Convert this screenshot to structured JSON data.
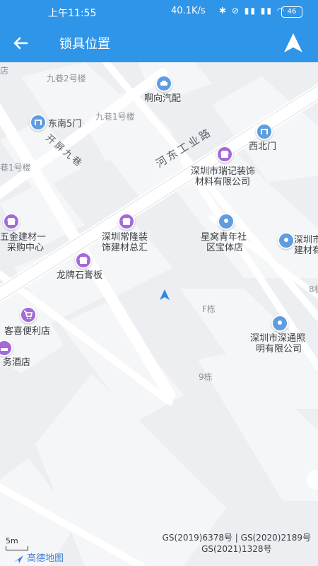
{
  "status": {
    "time": "上午11:55",
    "net": "40.1K/s",
    "battery": "46"
  },
  "appbar": {
    "title": "锁具位置"
  },
  "labels": {
    "l1": "九巷2号楼",
    "l2": "啊向汽配",
    "l3": "东南5门",
    "l4": "九巷1号楼",
    "l5": "西北门",
    "l6": "深圳市瑞记装饰",
    "l6b": "材料有限公司",
    "l7": "五金建材一",
    "l7b": "采购中心",
    "l8": "深圳常隆装",
    "l8b": "饰建材总汇",
    "l9": "星窝青年社",
    "l9b": "区宝体店",
    "l10": "深圳市",
    "l10b": "建材有",
    "l11": "龙牌石膏板",
    "l12": "F栋",
    "l13": "客喜便利店",
    "l14": "务酒店",
    "l15": "深圳市深通照",
    "l15b": "明有限公司",
    "l16": "9栋",
    "l17": "巷1号楼",
    "l18": "8栋",
    "l19": "店"
  },
  "roads": {
    "r1": "河东工业路",
    "r2": "开屏九巷"
  },
  "footer": {
    "gs1": "GS(2019)6378号 | GS(2020)2189号",
    "gs2": "GS(2021)1328号",
    "scale": "5m",
    "logo": "高德地图"
  }
}
